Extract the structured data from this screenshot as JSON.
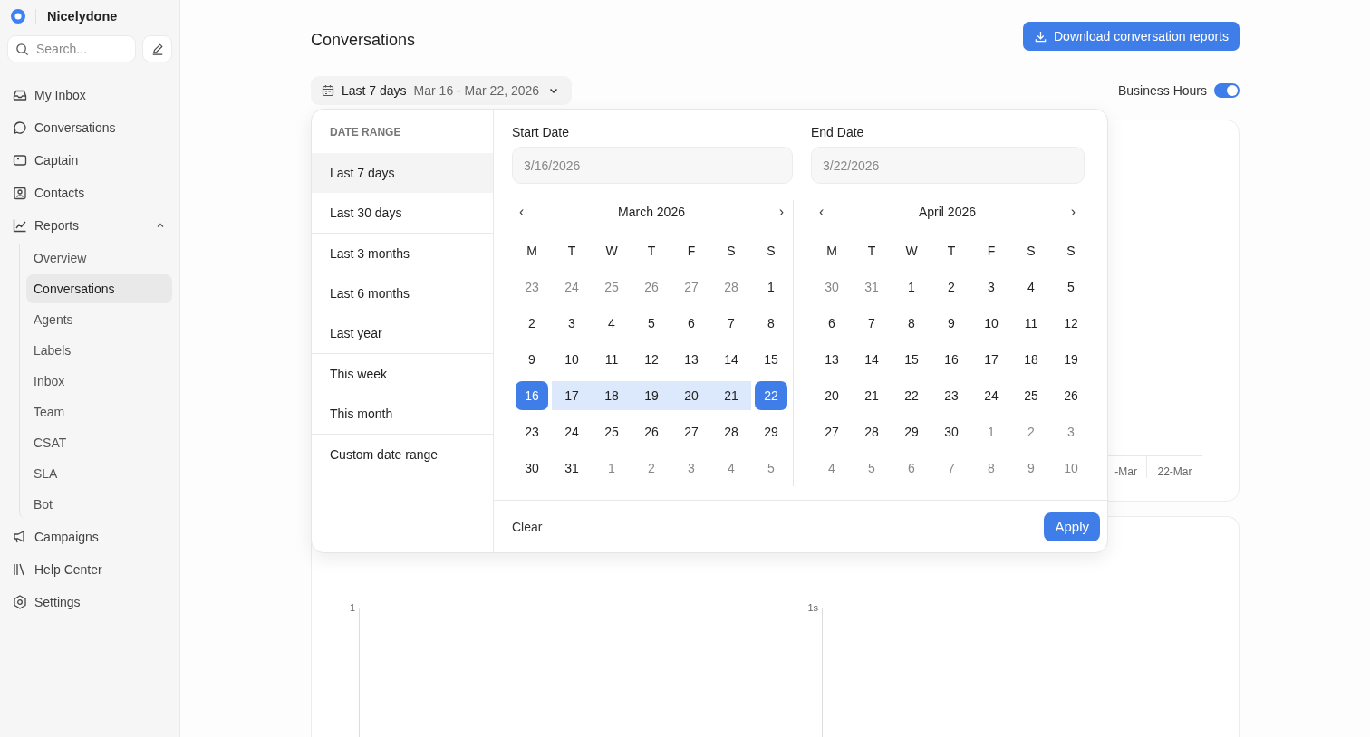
{
  "brand": {
    "name": "Nicelydone"
  },
  "search": {
    "placeholder": "Search..."
  },
  "nav": [
    {
      "label": "My Inbox"
    },
    {
      "label": "Conversations"
    },
    {
      "label": "Captain"
    },
    {
      "label": "Contacts"
    },
    {
      "label": "Reports",
      "expanded": true,
      "children": [
        {
          "label": "Overview",
          "selected": false
        },
        {
          "label": "Conversations",
          "selected": true
        },
        {
          "label": "Agents",
          "selected": false
        },
        {
          "label": "Labels",
          "selected": false
        },
        {
          "label": "Inbox",
          "selected": false
        },
        {
          "label": "Team",
          "selected": false
        },
        {
          "label": "CSAT",
          "selected": false
        },
        {
          "label": "SLA",
          "selected": false
        },
        {
          "label": "Bot",
          "selected": false
        }
      ]
    },
    {
      "label": "Campaigns"
    },
    {
      "label": "Help Center"
    },
    {
      "label": "Settings"
    }
  ],
  "page": {
    "title": "Conversations",
    "download_button": "Download conversation reports"
  },
  "date_filter": {
    "label": "Last 7 days",
    "range": "Mar 16 - Mar 22, 2026",
    "expanded": true
  },
  "business_hours": {
    "label": "Business Hours",
    "on": true
  },
  "popover": {
    "heading": "DATE RANGE",
    "preset_groups": [
      [
        {
          "label": "Last 7 days",
          "selected": true
        },
        {
          "label": "Last 30 days",
          "selected": false
        }
      ],
      [
        {
          "label": "Last 3 months",
          "selected": false
        },
        {
          "label": "Last 6 months",
          "selected": false
        },
        {
          "label": "Last year",
          "selected": false
        }
      ],
      [
        {
          "label": "This week",
          "selected": false
        },
        {
          "label": "This month",
          "selected": false
        }
      ],
      [
        {
          "label": "Custom date range",
          "selected": false
        }
      ]
    ],
    "start": {
      "label": "Start Date",
      "placeholder": "3/16/2026"
    },
    "end": {
      "label": "End Date",
      "placeholder": "3/22/2026"
    },
    "months": [
      {
        "title": "March 2026",
        "prev": "‹",
        "next": "›",
        "weekdays": [
          "M",
          "T",
          "W",
          "T",
          "F",
          "S",
          "S"
        ],
        "weeks": [
          [
            {
              "d": "23",
              "muted": true
            },
            {
              "d": "24",
              "muted": true
            },
            {
              "d": "25",
              "muted": true
            },
            {
              "d": "26",
              "muted": true
            },
            {
              "d": "27",
              "muted": true
            },
            {
              "d": "28",
              "muted": true
            },
            {
              "d": "1",
              "muted": false
            }
          ],
          [
            {
              "d": "2",
              "muted": false
            },
            {
              "d": "3",
              "muted": false
            },
            {
              "d": "4",
              "muted": false
            },
            {
              "d": "5",
              "muted": false
            },
            {
              "d": "6",
              "muted": false
            },
            {
              "d": "7",
              "muted": false
            },
            {
              "d": "8",
              "muted": false
            }
          ],
          [
            {
              "d": "9",
              "muted": false
            },
            {
              "d": "10",
              "muted": false
            },
            {
              "d": "11",
              "muted": false
            },
            {
              "d": "12",
              "muted": false
            },
            {
              "d": "13",
              "muted": false
            },
            {
              "d": "14",
              "muted": false
            },
            {
              "d": "15",
              "muted": false
            }
          ],
          [
            {
              "d": "16",
              "muted": false,
              "selected": true
            },
            {
              "d": "17",
              "muted": false,
              "in_range": true
            },
            {
              "d": "18",
              "muted": false,
              "in_range": true
            },
            {
              "d": "19",
              "muted": false,
              "in_range": true
            },
            {
              "d": "20",
              "muted": false,
              "in_range": true
            },
            {
              "d": "21",
              "muted": false,
              "in_range": true
            },
            {
              "d": "22",
              "muted": false,
              "selected": true
            }
          ],
          [
            {
              "d": "23",
              "muted": false
            },
            {
              "d": "24",
              "muted": false
            },
            {
              "d": "25",
              "muted": false
            },
            {
              "d": "26",
              "muted": false
            },
            {
              "d": "27",
              "muted": false
            },
            {
              "d": "28",
              "muted": false
            },
            {
              "d": "29",
              "muted": false
            }
          ],
          [
            {
              "d": "30",
              "muted": false
            },
            {
              "d": "31",
              "muted": false
            },
            {
              "d": "1",
              "muted": true
            },
            {
              "d": "2",
              "muted": true
            },
            {
              "d": "3",
              "muted": true
            },
            {
              "d": "4",
              "muted": true
            },
            {
              "d": "5",
              "muted": true
            }
          ]
        ]
      },
      {
        "title": "April 2026",
        "prev": "‹",
        "next": "›",
        "weekdays": [
          "M",
          "T",
          "W",
          "T",
          "F",
          "S",
          "S"
        ],
        "weeks": [
          [
            {
              "d": "30",
              "muted": true
            },
            {
              "d": "31",
              "muted": true
            },
            {
              "d": "1",
              "muted": false
            },
            {
              "d": "2",
              "muted": false
            },
            {
              "d": "3",
              "muted": false
            },
            {
              "d": "4",
              "muted": false
            },
            {
              "d": "5",
              "muted": false
            }
          ],
          [
            {
              "d": "6",
              "muted": false
            },
            {
              "d": "7",
              "muted": false
            },
            {
              "d": "8",
              "muted": false
            },
            {
              "d": "9",
              "muted": false
            },
            {
              "d": "10",
              "muted": false
            },
            {
              "d": "11",
              "muted": false
            },
            {
              "d": "12",
              "muted": false
            }
          ],
          [
            {
              "d": "13",
              "muted": false
            },
            {
              "d": "14",
              "muted": false
            },
            {
              "d": "15",
              "muted": false
            },
            {
              "d": "16",
              "muted": false
            },
            {
              "d": "17",
              "muted": false
            },
            {
              "d": "18",
              "muted": false
            },
            {
              "d": "19",
              "muted": false
            }
          ],
          [
            {
              "d": "20",
              "muted": false
            },
            {
              "d": "21",
              "muted": false
            },
            {
              "d": "22",
              "muted": false
            },
            {
              "d": "23",
              "muted": false
            },
            {
              "d": "24",
              "muted": false
            },
            {
              "d": "25",
              "muted": false
            },
            {
              "d": "26",
              "muted": false
            }
          ],
          [
            {
              "d": "27",
              "muted": false
            },
            {
              "d": "28",
              "muted": false
            },
            {
              "d": "29",
              "muted": false
            },
            {
              "d": "30",
              "muted": false
            },
            {
              "d": "1",
              "muted": true
            },
            {
              "d": "2",
              "muted": true
            },
            {
              "d": "3",
              "muted": true
            }
          ],
          [
            {
              "d": "4",
              "muted": true
            },
            {
              "d": "5",
              "muted": true
            },
            {
              "d": "6",
              "muted": true
            },
            {
              "d": "7",
              "muted": true
            },
            {
              "d": "8",
              "muted": true
            },
            {
              "d": "9",
              "muted": true
            },
            {
              "d": "10",
              "muted": true
            }
          ]
        ]
      }
    ],
    "clear": "Clear",
    "apply": "Apply"
  },
  "top_chart": {
    "x_labels": [
      "-Mar",
      "22-Mar"
    ]
  },
  "charts": [
    {
      "y_tick": "1"
    },
    {
      "y_tick": "1s"
    }
  ]
}
